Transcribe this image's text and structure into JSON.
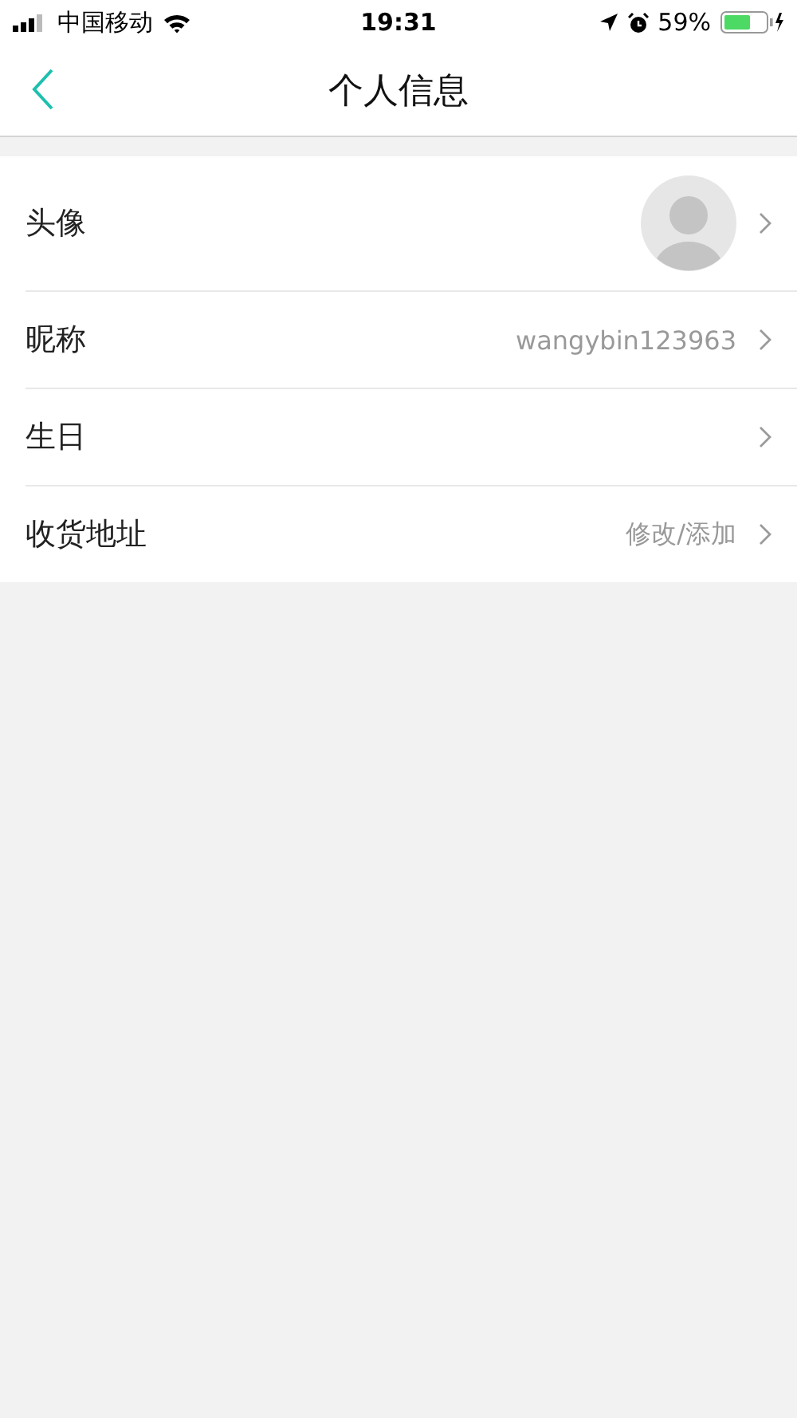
{
  "status_bar": {
    "carrier": "中国移动",
    "time": "19:31",
    "battery": "59%"
  },
  "nav": {
    "title": "个人信息"
  },
  "rows": [
    {
      "kind": "avatar",
      "label": "头像"
    },
    {
      "kind": "text",
      "label": "昵称",
      "value": "wangybin123963"
    },
    {
      "kind": "text",
      "label": "生日"
    },
    {
      "kind": "text",
      "label": "收货地址",
      "value": "修改/添加"
    }
  ]
}
